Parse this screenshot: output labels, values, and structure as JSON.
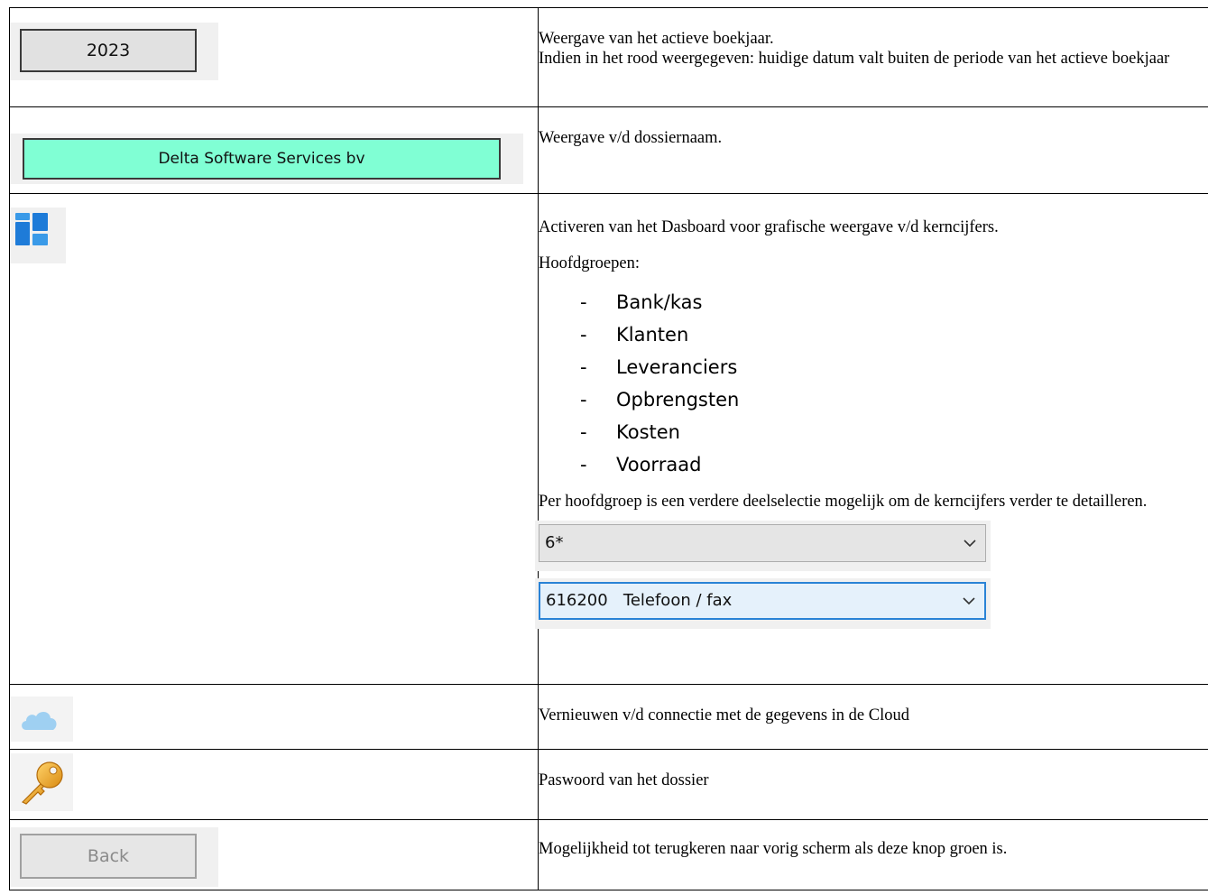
{
  "rows": [
    {
      "button_label": "2023",
      "desc": [
        "Weergave van het actieve boekjaar.",
        "Indien in het rood weergegeven: huidige datum valt buiten de periode van het actieve boekjaar"
      ]
    },
    {
      "button_label": "Delta Software Services bv",
      "button_color": "#80ffd4",
      "desc": [
        "Weergave v/d dossiernaam."
      ]
    },
    {
      "icon": "dashboard-icon",
      "desc_intro": "Activeren van het Dasboard voor grafische weergave v/d kerncijfers.",
      "groups_heading": "Hoofdgroepen:",
      "groups": [
        "Bank/kas",
        "Klanten",
        "Leveranciers",
        "Opbrengsten",
        "Kosten",
        "Voorraad"
      ],
      "bullet": "-",
      "desc_detail": "Per hoofdgroep is een verdere deelselectie mogelijk om de kerncijfers verder te detailleren.",
      "combo1_value": "6*",
      "combo2_value": "616200   Telefoon / fax"
    },
    {
      "icon": "cloud-icon",
      "desc": [
        "Vernieuwen v/d connectie met de gegevens in de Cloud"
      ]
    },
    {
      "icon": "key-icon",
      "desc": [
        "Paswoord van het dossier"
      ]
    },
    {
      "button_label": "Back",
      "desc": [
        "Mogelijkheid tot terugkeren naar vorig scherm als deze knop groen is."
      ]
    }
  ]
}
